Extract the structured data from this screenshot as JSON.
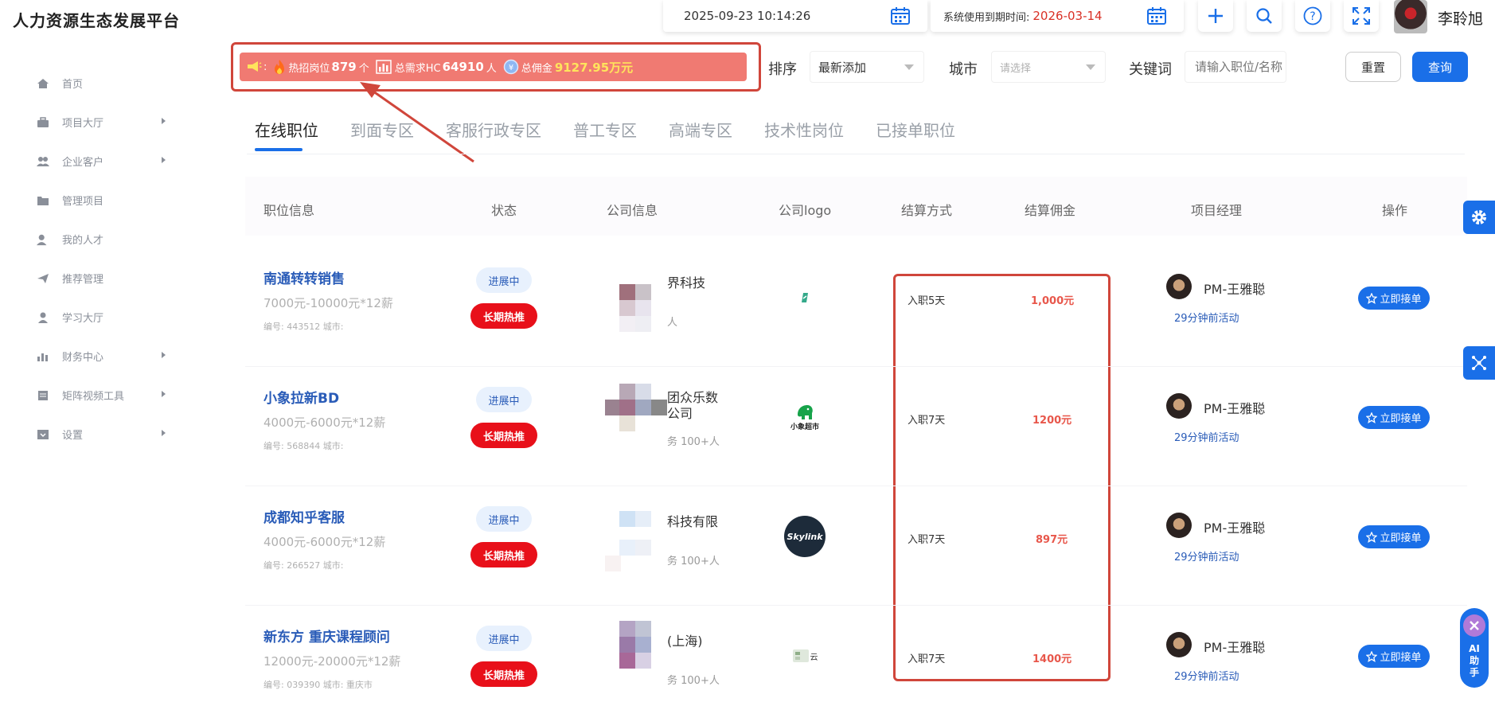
{
  "app": {
    "title": "人力资源生态发展平台"
  },
  "topbar": {
    "datetime": "2025-09-23 10:14:26",
    "expiry_label": "系统使用到期时间:",
    "expiry_date": "2026-03-14",
    "user_name": "李聆旭"
  },
  "sidebar": {
    "items": [
      {
        "label": "首页",
        "icon": "home-icon",
        "has_arrow": false
      },
      {
        "label": "项目大厅",
        "icon": "briefcase-icon",
        "has_arrow": true
      },
      {
        "label": "企业客户",
        "icon": "users-icon",
        "has_arrow": true
      },
      {
        "label": "管理项目",
        "icon": "folder-icon",
        "has_arrow": false
      },
      {
        "label": "我的人才",
        "icon": "person-icon",
        "has_arrow": false
      },
      {
        "label": "推荐管理",
        "icon": "send-icon",
        "has_arrow": false
      },
      {
        "label": "学习大厅",
        "icon": "user-icon",
        "has_arrow": false
      },
      {
        "label": "财务中心",
        "icon": "bar-chart-icon",
        "has_arrow": true
      },
      {
        "label": "矩阵视频工具",
        "icon": "document-icon",
        "has_arrow": true
      },
      {
        "label": "设置",
        "icon": "download-box-icon",
        "has_arrow": true
      }
    ]
  },
  "stats": {
    "colon": ":",
    "hot_label": "热招岗位",
    "hot_value": "879",
    "hot_unit": "个",
    "hc_label": "总需求HC",
    "hc_value": "64910",
    "hc_unit": "人",
    "commission_label": "总佣金",
    "commission_value": "9127.95万元"
  },
  "filters": {
    "sort_label": "排序",
    "sort_value": "最新添加",
    "city_label": "城市",
    "city_placeholder": "请选择",
    "keyword_label": "关键词",
    "keyword_placeholder": "请输入职位/名称",
    "reset_label": "重置",
    "query_label": "查询"
  },
  "tabs": [
    "在线职位",
    "到面专区",
    "客服行政专区",
    "普工专区",
    "高端专区",
    "技术性岗位",
    "已接单职位"
  ],
  "table": {
    "headers": [
      "职位信息",
      "状态",
      "公司信息",
      "公司logo",
      "结算方式",
      "结算佣金",
      "项目经理",
      "操作"
    ],
    "rows": [
      {
        "title": "南通转转销售",
        "salary": "7000元-10000元*12薪",
        "meta": "编号: 443512 城市:",
        "status": "进展中",
        "tag": "长期热推",
        "company": "界科技",
        "company_sub": "人",
        "logo": "leaf-logo-icon",
        "settle_way": "入职5天",
        "settle_amt": "1,000元",
        "pm": "PM-王雅聪",
        "activity": "29分钟前活动",
        "action": "立即接单"
      },
      {
        "title": "小象拉新BD",
        "salary": "4000元-6000元*12薪",
        "meta": "编号: 568844 城市:",
        "status": "进展中",
        "tag": "长期热推",
        "company": "团众乐数\n公司",
        "company_sub": "务 100+人",
        "logo": "elephant-logo-icon",
        "logo_text": "小象超市",
        "settle_way": "入职7天",
        "settle_amt": "1200元",
        "pm": "PM-王雅聪",
        "activity": "29分钟前活动",
        "action": "立即接单"
      },
      {
        "title": "成都知乎客服",
        "salary": "4000元-6000元*12薪",
        "meta": "编号: 266527 城市:",
        "status": "进展中",
        "tag": "长期热推",
        "company": "科技有限",
        "company_sub": "务 100+人",
        "logo": "skylink-logo-icon",
        "logo_text": "Skylink",
        "settle_way": "入职7天",
        "settle_amt": "897元",
        "pm": "PM-王雅聪",
        "activity": "29分钟前活动",
        "action": "立即接单"
      },
      {
        "title": "新东方 重庆课程顾问",
        "salary": "12000元-20000元*12薪",
        "meta": "编号: 039390 城市: 重庆市",
        "status": "进展中",
        "tag": "长期热推",
        "company": "(上海)",
        "company_sub": "务 100+人",
        "logo": "cloud-logo-icon",
        "logo_text": "云",
        "settle_way": "入职7天",
        "settle_amt": "1400元",
        "pm": "PM-王雅聪",
        "activity": "29分钟前活动",
        "action": "立即接单"
      }
    ]
  },
  "float": {
    "ai_label_1": "AI",
    "ai_label_2": "助",
    "ai_label_3": "手"
  },
  "colors": {
    "primary": "#1a6fe8",
    "banner": "#f07a72",
    "hot": "#e8101a",
    "highlight_outline": "#d0463b"
  }
}
